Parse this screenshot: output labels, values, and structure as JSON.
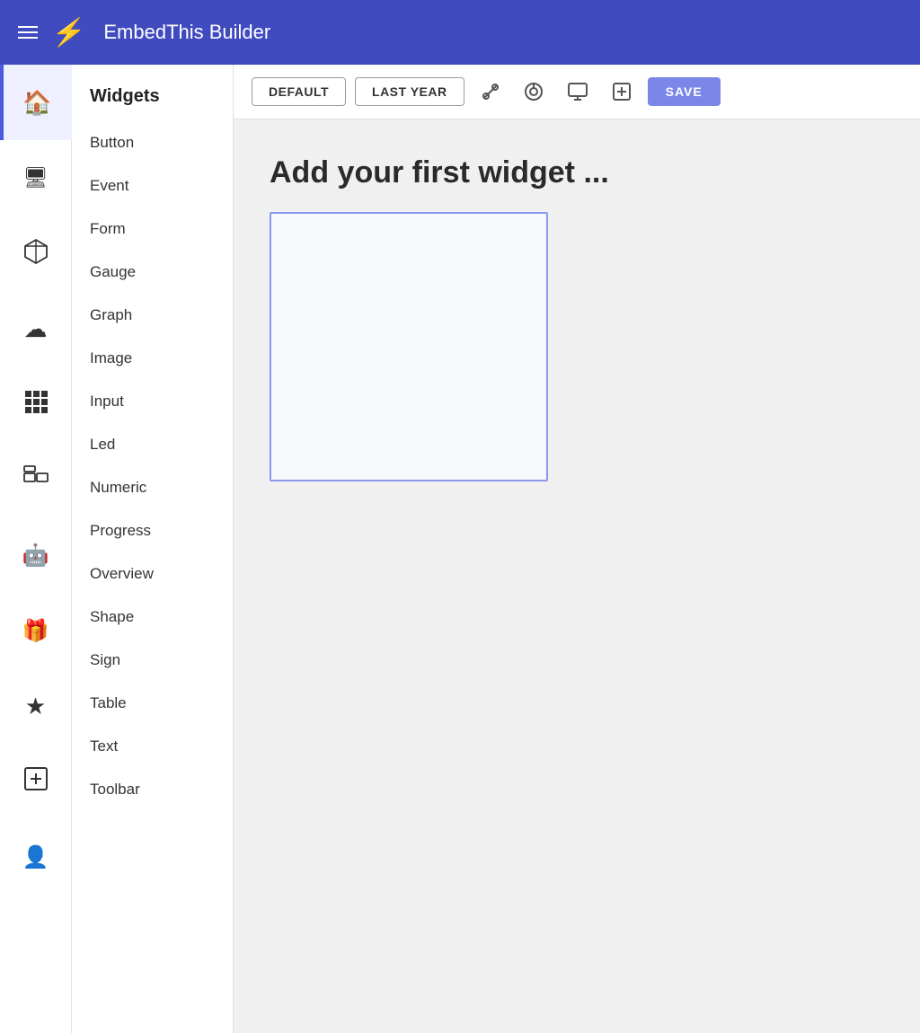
{
  "header": {
    "title": "EmbedThis Builder",
    "logo_char": "⚡",
    "menu_icon": "☰"
  },
  "toolbar": {
    "buttons": [
      "DEFAULT",
      "LAST YEAR"
    ],
    "save_label": "SAVE"
  },
  "widget_sidebar": {
    "title": "Widgets",
    "items": [
      "Button",
      "Event",
      "Form",
      "Gauge",
      "Graph",
      "Image",
      "Input",
      "Led",
      "Numeric",
      "Progress",
      "Overview",
      "Shape",
      "Sign",
      "Table",
      "Text",
      "Toolbar"
    ]
  },
  "canvas": {
    "empty_label": "Add your first widget ..."
  },
  "icon_sidebar": {
    "items": [
      {
        "name": "home",
        "char": "🏠"
      },
      {
        "name": "monitor",
        "char": "🖥"
      },
      {
        "name": "cube",
        "char": "⬡"
      },
      {
        "name": "cloud",
        "char": "☁"
      },
      {
        "name": "grid",
        "char": "⣿"
      },
      {
        "name": "device-group",
        "char": "⧉"
      },
      {
        "name": "robot",
        "char": "🤖"
      },
      {
        "name": "gift",
        "char": "🎁"
      },
      {
        "name": "star",
        "char": "★"
      },
      {
        "name": "plus-box",
        "char": "⊞"
      },
      {
        "name": "user",
        "char": "👤"
      }
    ]
  }
}
